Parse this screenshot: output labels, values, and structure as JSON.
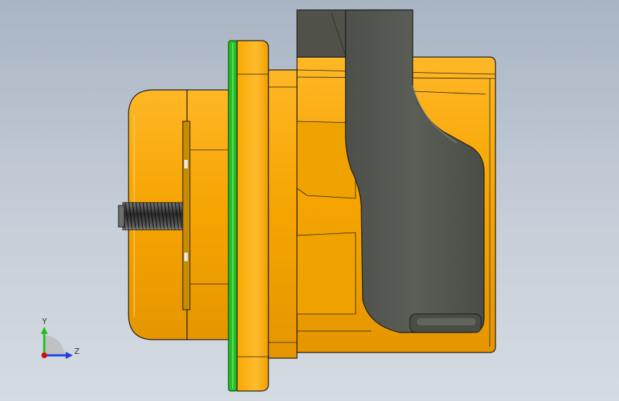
{
  "viewport": {
    "background_top": "#a9b4c3",
    "background_bottom": "#d5dbe2"
  },
  "model": {
    "body_color": "#f5a800",
    "body_highlight": "#ffc23a",
    "body_shadow": "#d98f00",
    "latch_color": "#545750",
    "latch_dark": "#3e403b",
    "gasket_color": "#22c022",
    "edge_color": "#1a1a1a"
  },
  "triad": {
    "y_label": "Y",
    "z_label": "Z",
    "y_color": "#1fbf1f",
    "z_color": "#1f3fdf",
    "origin_color": "#d01010"
  }
}
